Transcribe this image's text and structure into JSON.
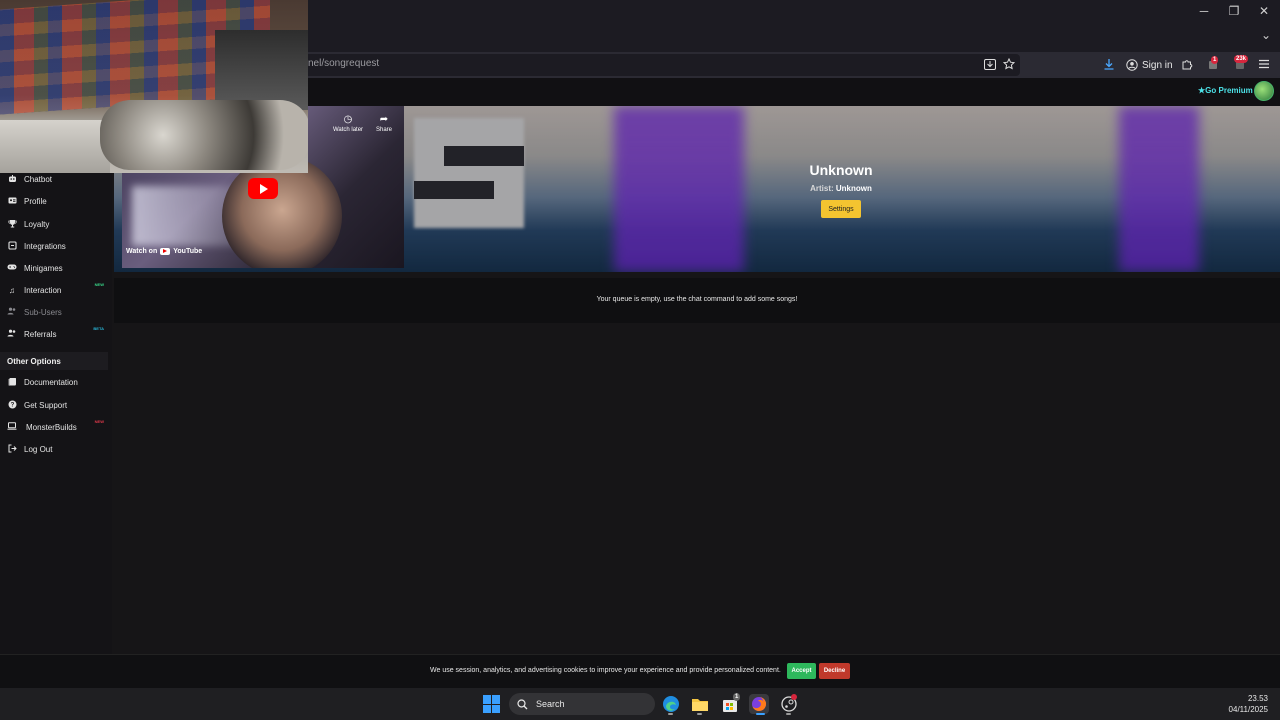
{
  "browser": {
    "url_text": "nel/songrequest",
    "sign_in_label": "Sign in",
    "extension_badge_1": "1",
    "extension_badge_2": "23k",
    "window_controls": {
      "minimize": "─",
      "restore": "❐",
      "close": "✕",
      "list_tabs": "⌄"
    }
  },
  "site_header": {
    "go_premium_label": "Go Premium"
  },
  "sidebar": {
    "items": [
      {
        "label": "Chatbot",
        "icon": "robot-icon"
      },
      {
        "label": "Profile",
        "icon": "profile-icon"
      },
      {
        "label": "Loyalty",
        "icon": "trophy-icon"
      },
      {
        "label": "Integrations",
        "icon": "integrations-icon"
      },
      {
        "label": "Minigames",
        "icon": "gamepad-icon"
      },
      {
        "label": "Interaction",
        "icon": "music-note-icon",
        "tag": "NEW"
      },
      {
        "label": "Sub-Users",
        "icon": "users-icon"
      },
      {
        "label": "Referrals",
        "icon": "referrals-icon",
        "tag": "BETA"
      }
    ],
    "other_options_title": "Other Options",
    "other_items": [
      {
        "label": "Documentation",
        "icon": "book-icon"
      },
      {
        "label": "Get Support",
        "icon": "help-icon"
      },
      {
        "label": "MonsterBuilds",
        "icon": "laptop-icon",
        "tag": "NEW"
      },
      {
        "label": "Log Out",
        "icon": "logout-icon"
      }
    ]
  },
  "video": {
    "watch_later_label": "Watch later",
    "share_label": "Share",
    "watch_on_label": "Watch on",
    "youtube_label": "YouTube"
  },
  "now_playing": {
    "title": "Unknown",
    "artist_label": "Artist:",
    "artist_value": "Unknown",
    "settings_label": "Settings"
  },
  "queue": {
    "empty_message": "Your queue is empty, use the chat command to add some songs!"
  },
  "cookie_bar": {
    "message": "We use session, analytics, and advertising cookies to improve your experience and provide personalized content.",
    "accept_label": "Accept",
    "decline_label": "Decline"
  },
  "taskbar": {
    "search_label": "Search",
    "store_badge": "1",
    "time": "23.53",
    "date": "04/11/2025"
  },
  "colors": {
    "accent_yellow": "#f4c430",
    "accept_green": "#2eb85c",
    "decline_red": "#c0392b",
    "premium_cyan": "#4de2e8",
    "new_tag_green": "#39d98a",
    "beta_tag_cyan": "#29b6d8",
    "new_tag_red": "#e0394a"
  }
}
